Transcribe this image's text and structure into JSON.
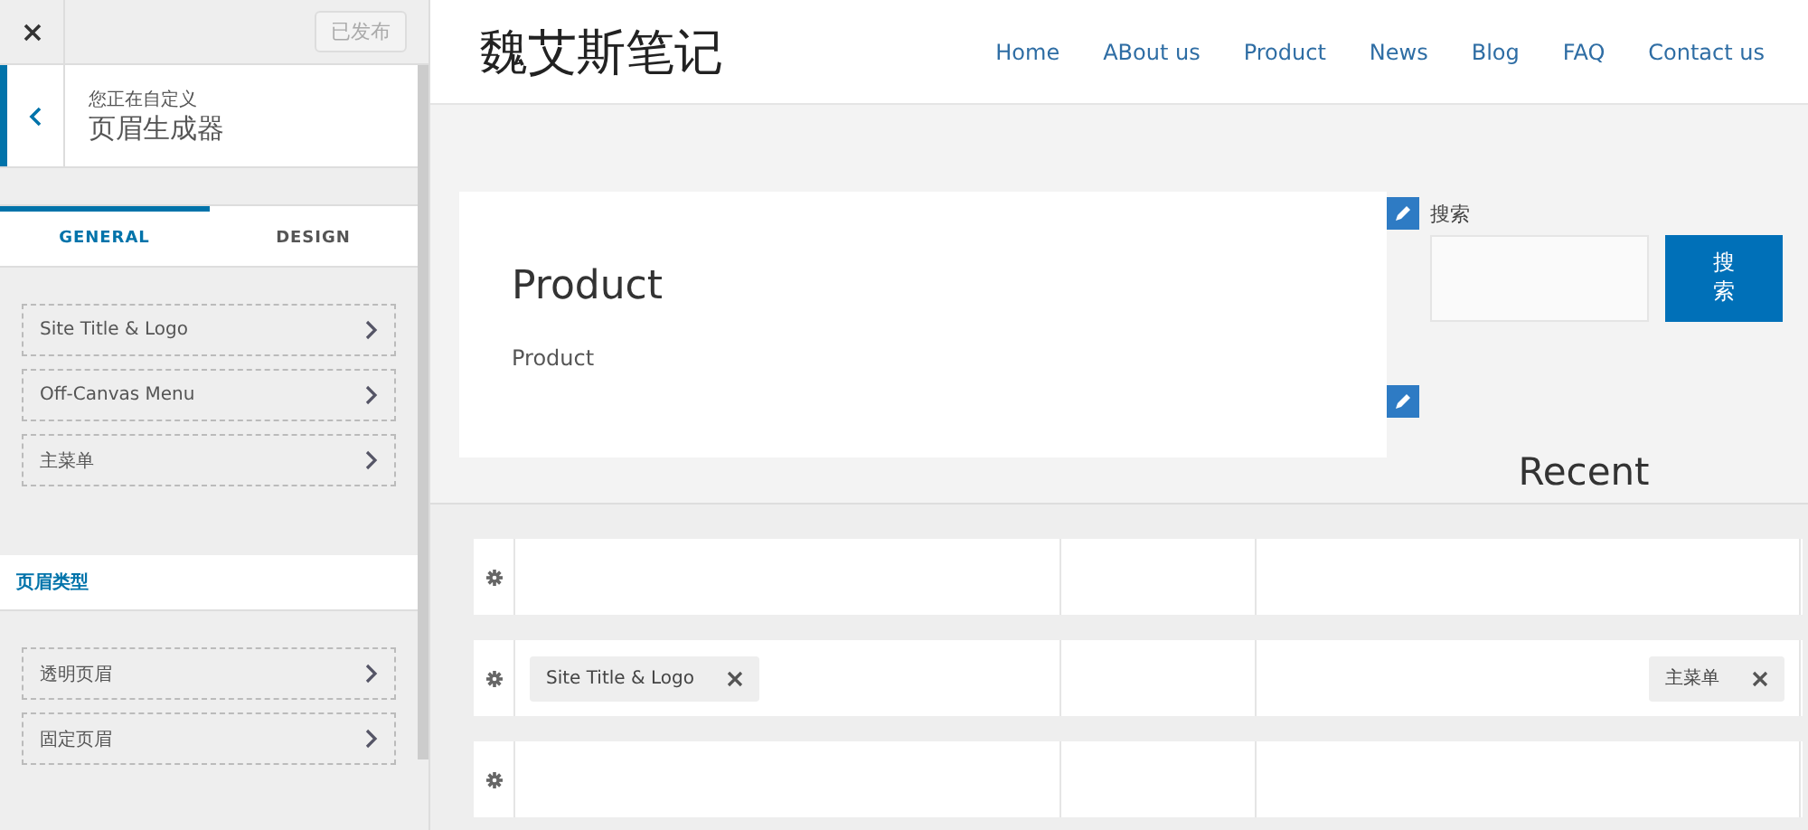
{
  "sidebar": {
    "publish_button": {
      "label": "已发布",
      "disabled": true
    },
    "customizing": {
      "label": "您正在自定义",
      "title": "页眉生成器"
    },
    "tabs": [
      {
        "label": "GENERAL",
        "selected": true
      },
      {
        "label": "DESIGN",
        "selected": false
      }
    ],
    "items": [
      {
        "label": "Site Title & Logo"
      },
      {
        "label": "Off-Canvas Menu"
      },
      {
        "label": "主菜单"
      }
    ],
    "section": {
      "title": "页眉类型"
    },
    "section_items": [
      {
        "label": "透明页眉"
      },
      {
        "label": "固定页眉"
      }
    ]
  },
  "preview": {
    "site_title": "魏艾斯笔记",
    "nav": [
      {
        "label": "Home"
      },
      {
        "label": "ABout us"
      },
      {
        "label": "Product"
      },
      {
        "label": "News"
      },
      {
        "label": "Blog"
      },
      {
        "label": "FAQ"
      },
      {
        "label": "Contact us"
      }
    ],
    "page": {
      "title": "Product",
      "text": "Product"
    },
    "search": {
      "label": "搜索",
      "button": "搜索"
    },
    "widget_title": "Recent"
  },
  "builder": {
    "rows": [
      {},
      {
        "left": [
          {
            "label": "Site Title & Logo"
          }
        ],
        "right": [
          {
            "label": "主菜单"
          }
        ]
      },
      {}
    ]
  }
}
